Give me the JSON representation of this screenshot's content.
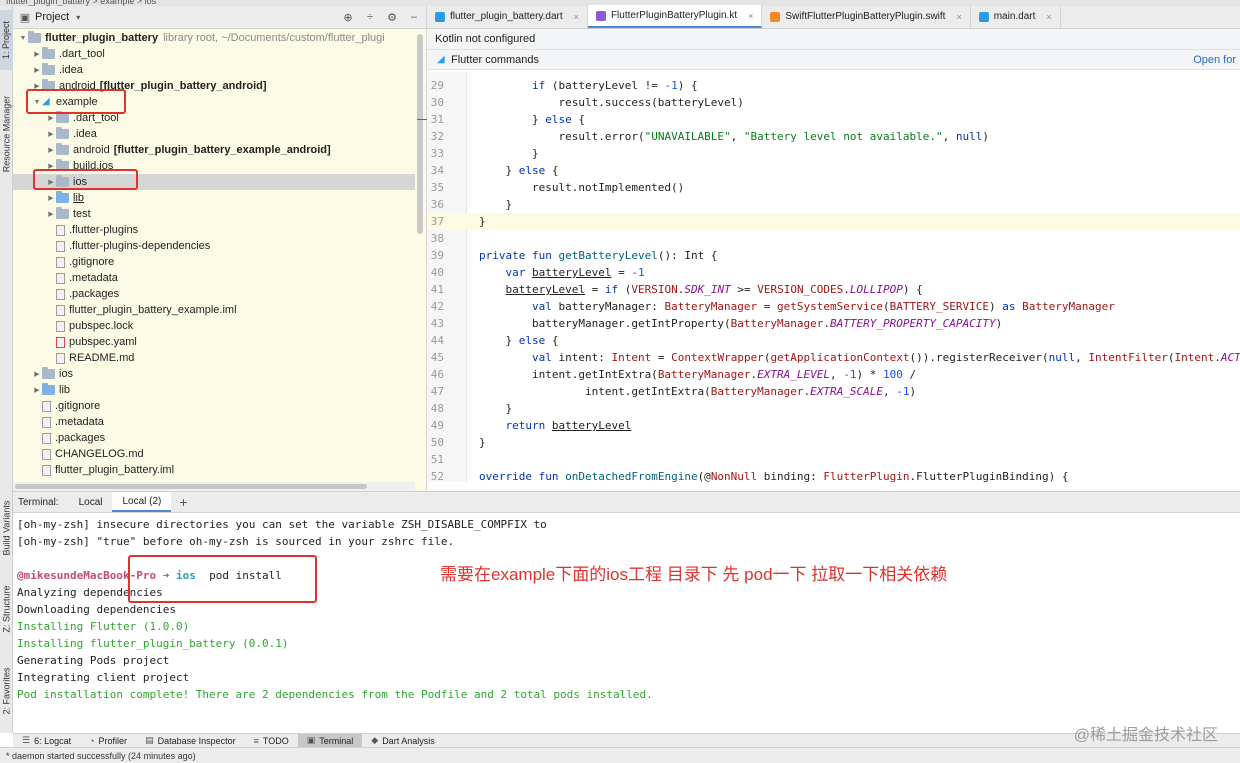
{
  "window": {
    "breadcrumb": "flutter_plugin_battery  >  example  >  ios"
  },
  "left_strip": {
    "tabs": [
      "1: Project",
      "Resource Manager",
      "Build Variants",
      "Z: Structure",
      "2: Favorites"
    ]
  },
  "project": {
    "title": "Project",
    "tree": [
      {
        "depth": 0,
        "icon": "folder",
        "label": "flutter_plugin_battery",
        "suffix": "library root, ~/Documents/custom/flutter_plugi",
        "bold": true,
        "arrow": "open"
      },
      {
        "depth": 1,
        "icon": "folder",
        "label": ".dart_tool",
        "arrow": "closed"
      },
      {
        "depth": 1,
        "icon": "folder",
        "label": ".idea",
        "arrow": "closed"
      },
      {
        "depth": 1,
        "icon": "folder",
        "label": "android",
        "suffix_bold": "[flutter_plugin_battery_android]",
        "arrow": "closed"
      },
      {
        "depth": 1,
        "icon": "flutter",
        "label": "example",
        "arrow": "open"
      },
      {
        "depth": 2,
        "icon": "folder",
        "label": ".dart_tool",
        "arrow": "closed"
      },
      {
        "depth": 2,
        "icon": "folder",
        "label": ".idea",
        "arrow": "closed"
      },
      {
        "depth": 2,
        "icon": "folder",
        "label": "android",
        "suffix_bold": "[flutter_plugin_battery_example_android]",
        "arrow": "closed"
      },
      {
        "depth": 2,
        "icon": "folder",
        "label": "build.ios",
        "arrow": "closed"
      },
      {
        "depth": 2,
        "icon": "folder",
        "label": "ios",
        "arrow": "closed",
        "selected": true
      },
      {
        "depth": 2,
        "icon": "folder-blue",
        "label": "lib",
        "arrow": "closed",
        "underline": true
      },
      {
        "depth": 2,
        "icon": "folder",
        "label": "test",
        "arrow": "closed"
      },
      {
        "depth": 2,
        "icon": "file",
        "label": ".flutter-plugins"
      },
      {
        "depth": 2,
        "icon": "file",
        "label": ".flutter-plugins-dependencies"
      },
      {
        "depth": 2,
        "icon": "file",
        "label": ".gitignore"
      },
      {
        "depth": 2,
        "icon": "file",
        "label": ".metadata"
      },
      {
        "depth": 2,
        "icon": "file",
        "label": ".packages"
      },
      {
        "depth": 2,
        "icon": "file",
        "label": "flutter_plugin_battery_example.iml"
      },
      {
        "depth": 2,
        "icon": "file",
        "label": "pubspec.lock"
      },
      {
        "depth": 2,
        "icon": "yaml",
        "label": "pubspec.yaml"
      },
      {
        "depth": 2,
        "icon": "file",
        "label": "README.md"
      },
      {
        "depth": 1,
        "icon": "folder",
        "label": "ios",
        "arrow": "closed"
      },
      {
        "depth": 1,
        "icon": "folder-blue",
        "label": "lib",
        "arrow": "closed"
      },
      {
        "depth": 1,
        "icon": "file",
        "label": ".gitignore"
      },
      {
        "depth": 1,
        "icon": "file",
        "label": ".metadata"
      },
      {
        "depth": 1,
        "icon": "file",
        "label": ".packages"
      },
      {
        "depth": 1,
        "icon": "file",
        "label": "CHANGELOG.md"
      },
      {
        "depth": 1,
        "icon": "file",
        "label": "flutter_plugin_battery.iml"
      }
    ]
  },
  "editor": {
    "tabs": [
      {
        "label": "flutter_plugin_battery.dart",
        "icon_color": "#2e9be8"
      },
      {
        "label": "FlutterPluginBatteryPlugin.kt",
        "icon_color": "#8e5bd6",
        "active": true
      },
      {
        "label": "SwiftFlutterPluginBatteryPlugin.swift",
        "icon_color": "#f08a24"
      },
      {
        "label": "main.dart",
        "icon_color": "#2e9be8"
      }
    ],
    "kotlin_banner": "Kotlin not configured",
    "flutter_banner": "Flutter commands",
    "flutter_banner_action": "Open for",
    "code_start_line": 29,
    "current_line": 37
  },
  "terminal": {
    "label": "Terminal:",
    "tabs": [
      "Local",
      "Local (2)"
    ],
    "active_tab": 1,
    "lines": [
      {
        "text": "[oh-my-zsh] insecure directories you can set the variable ZSH_DISABLE_COMPFIX to",
        "color": "default"
      },
      {
        "text": "[oh-my-zsh] \"true\" before oh-my-zsh is sourced in your zshrc file.",
        "color": "default"
      },
      {
        "text": "",
        "color": "default"
      },
      {
        "prompt_user": "@mikesundeMacBook-Pro",
        "prompt_arrow": "➜",
        "prompt_dir": "ios",
        "prompt_cmd": "pod install"
      },
      {
        "text": "Analyzing dependencies",
        "color": "default"
      },
      {
        "text": "Downloading dependencies",
        "color": "default"
      },
      {
        "text": "Installing Flutter (1.0.0)",
        "color": "green"
      },
      {
        "text": "Installing flutter_plugin_battery (0.0.1)",
        "color": "green"
      },
      {
        "text": "Generating Pods project",
        "color": "default"
      },
      {
        "text": "Integrating client project",
        "color": "default"
      },
      {
        "text": "Pod installation complete! There are 2 dependencies from the Podfile and 2 total pods installed.",
        "color": "green"
      }
    ],
    "annotation": "需要在example下面的ios工程 目录下 先 pod一下 拉取一下相关依赖"
  },
  "bottom_tools": [
    {
      "label": "6: Logcat",
      "icon": "logcat-icon"
    },
    {
      "label": "Profiler",
      "icon": "profiler-icon"
    },
    {
      "label": "Database Inspector",
      "icon": "database-icon"
    },
    {
      "label": "TODO",
      "icon": "todo-icon"
    },
    {
      "label": "Terminal",
      "icon": "terminal-icon",
      "active": true
    },
    {
      "label": "Dart Analysis",
      "icon": "dart-icon"
    }
  ],
  "status": "* daemon started successfully (24 minutes ago)",
  "watermark": "@稀土掘金技术社区",
  "colors": {
    "highlight": "#e0312c",
    "accent": "#4a88d7",
    "tree_bg": "#fcfce6"
  }
}
